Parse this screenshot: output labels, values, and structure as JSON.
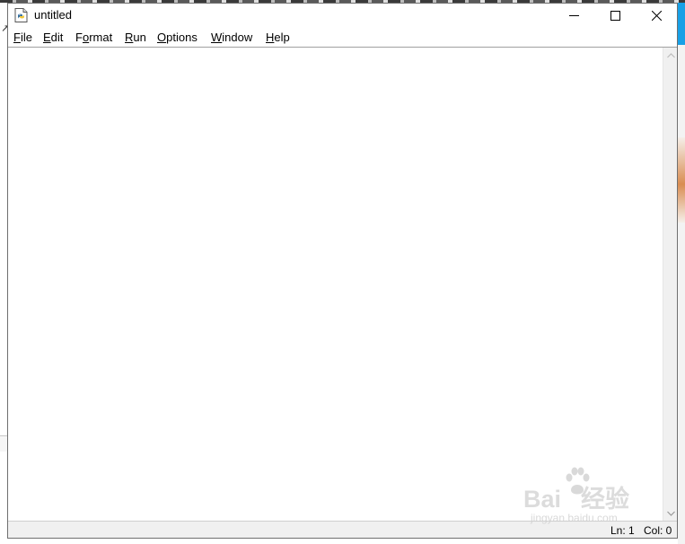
{
  "window": {
    "title": "untitled",
    "app_icon": "python-file-icon",
    "controls": {
      "minimize": "minimize-icon",
      "maximize": "maximize-icon",
      "close": "close-icon"
    }
  },
  "menu": {
    "items": [
      {
        "mnemonic": "F",
        "rest": "ile"
      },
      {
        "mnemonic": "E",
        "rest": "dit"
      },
      {
        "mnemonic": "",
        "rest_pre": "F",
        "mnemonic_mid": "o",
        "rest": "rmat"
      },
      {
        "mnemonic": "R",
        "rest": "un"
      },
      {
        "mnemonic": "O",
        "rest": "ptions"
      },
      {
        "mnemonic": "W",
        "rest": "indow"
      },
      {
        "mnemonic": "H",
        "rest": "elp"
      }
    ]
  },
  "editor": {
    "content": ""
  },
  "status": {
    "ln": "Ln: 1",
    "col": "Col: 0"
  },
  "watermark": {
    "main": "Bai",
    "main2": "经验",
    "sub": "jingyan.baidu.com"
  }
}
